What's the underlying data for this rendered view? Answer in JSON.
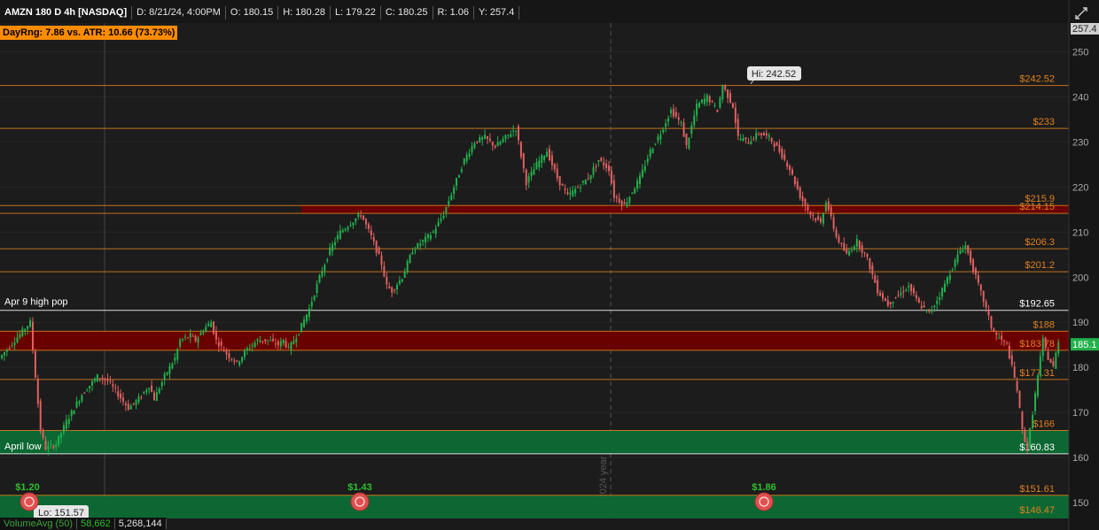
{
  "header": {
    "symbol": "AMZN 180 D 4h [NASDAQ]",
    "date": "D: 8/21/24, 4:00PM",
    "open": "O: 180.15",
    "high": "H: 180.28",
    "low": "L: 179.22",
    "close": "C: 180.25",
    "range": "R: 1.06",
    "y": "Y: 257.4"
  },
  "day_range_badge": "DayRng: 7.86 vs. ATR: 10.66 (73.73%)",
  "year_separator_label": "2024 year",
  "labels": {
    "apr9": "Apr 9 high pop",
    "april_low": "April low",
    "hi": "Hi: 242.52",
    "lo": "Lo: 151.57"
  },
  "dividends": [
    "$1.20",
    "$1.43",
    "$1.86"
  ],
  "price_axis": {
    "ticks": [
      "250",
      "240",
      "230",
      "220",
      "210",
      "200",
      "190",
      "180",
      "170",
      "160",
      "150"
    ],
    "top_value": "257.4",
    "current_price": "185.1"
  },
  "levels": [
    {
      "label": "$242.52",
      "color": "#e08020"
    },
    {
      "label": "$233",
      "color": "#e08020"
    },
    {
      "label": "$215.9",
      "color": "#e08020"
    },
    {
      "label": "$214.15",
      "color": "#e08020"
    },
    {
      "label": "$206.3",
      "color": "#e08020"
    },
    {
      "label": "$201.2",
      "color": "#e08020"
    },
    {
      "label": "$192.65",
      "color": "#ffffff"
    },
    {
      "label": "$188",
      "color": "#e08020"
    },
    {
      "label": "$183.78",
      "color": "#e08020"
    },
    {
      "label": "$177.31",
      "color": "#e08020"
    },
    {
      "label": "$166",
      "color": "#e08020"
    },
    {
      "label": "$160.83",
      "color": "#ffffff"
    },
    {
      "label": "$151.61",
      "color": "#e08020"
    },
    {
      "label": "$146.47",
      "color": "#e08020"
    }
  ],
  "volume": {
    "name": "VolumeAvg (50)",
    "avg": "58,662",
    "value": "5,268,144"
  },
  "colors": {
    "up": "#22b14c",
    "down": "#e06060",
    "red_zone": "#6e0000",
    "green_zone": "#0c6b34",
    "level_line": "#e08020"
  },
  "chart_data": {
    "type": "candlestick",
    "ylim": [
      145,
      257.4
    ],
    "price_path": [
      [
        0,
        182
      ],
      [
        3,
        186
      ],
      [
        6,
        190
      ],
      [
        7,
        178
      ],
      [
        8,
        166
      ],
      [
        9,
        162
      ],
      [
        11,
        163
      ],
      [
        13,
        168
      ],
      [
        16,
        174
      ],
      [
        19,
        178
      ],
      [
        21,
        177
      ],
      [
        23,
        174
      ],
      [
        25,
        171
      ],
      [
        27,
        173
      ],
      [
        29,
        176
      ],
      [
        30,
        173
      ],
      [
        32,
        178
      ],
      [
        34,
        182
      ],
      [
        35,
        186
      ],
      [
        37,
        187
      ],
      [
        38,
        186
      ],
      [
        40,
        189
      ],
      [
        41,
        190
      ],
      [
        42,
        186
      ],
      [
        44,
        183
      ],
      [
        46,
        181
      ],
      [
        48,
        184
      ],
      [
        50,
        186
      ],
      [
        52,
        186
      ],
      [
        54,
        185
      ],
      [
        55,
        186
      ],
      [
        56,
        184
      ],
      [
        58,
        188
      ],
      [
        60,
        193
      ],
      [
        62,
        200
      ],
      [
        64,
        206
      ],
      [
        66,
        210
      ],
      [
        68,
        212
      ],
      [
        70,
        214
      ],
      [
        72,
        209
      ],
      [
        74,
        203
      ],
      [
        75,
        198
      ],
      [
        76,
        197
      ],
      [
        78,
        200
      ],
      [
        80,
        206
      ],
      [
        82,
        208
      ],
      [
        84,
        210
      ],
      [
        86,
        214
      ],
      [
        88,
        220
      ],
      [
        90,
        226
      ],
      [
        92,
        230
      ],
      [
        94,
        231
      ],
      [
        96,
        229
      ],
      [
        98,
        231
      ],
      [
        100,
        233
      ],
      [
        101,
        227
      ],
      [
        102,
        221
      ],
      [
        104,
        225
      ],
      [
        106,
        228
      ],
      [
        108,
        222
      ],
      [
        110,
        218
      ],
      [
        112,
        220
      ],
      [
        114,
        222
      ],
      [
        116,
        226
      ],
      [
        118,
        224
      ],
      [
        119,
        218
      ],
      [
        121,
        216
      ],
      [
        122,
        218
      ],
      [
        124,
        222
      ],
      [
        126,
        228
      ],
      [
        128,
        232
      ],
      [
        130,
        237
      ],
      [
        132,
        234
      ],
      [
        133,
        229
      ],
      [
        135,
        238
      ],
      [
        137,
        240
      ],
      [
        139,
        237
      ],
      [
        140,
        242.5
      ],
      [
        142,
        238
      ],
      [
        143,
        231
      ],
      [
        145,
        230
      ],
      [
        147,
        232
      ],
      [
        149,
        231
      ],
      [
        151,
        228
      ],
      [
        153,
        224
      ],
      [
        155,
        218
      ],
      [
        157,
        214
      ],
      [
        159,
        212
      ],
      [
        160,
        217
      ],
      [
        162,
        209
      ],
      [
        164,
        205
      ],
      [
        166,
        208
      ],
      [
        168,
        204
      ],
      [
        170,
        197
      ],
      [
        172,
        194
      ],
      [
        174,
        196
      ],
      [
        176,
        198
      ],
      [
        178,
        194
      ],
      [
        180,
        192
      ],
      [
        182,
        196
      ],
      [
        184,
        201
      ],
      [
        186,
        206
      ],
      [
        187,
        207
      ],
      [
        189,
        200
      ],
      [
        191,
        193
      ],
      [
        192,
        189
      ],
      [
        193,
        187
      ],
      [
        195,
        185
      ],
      [
        197,
        175
      ],
      [
        198,
        166
      ],
      [
        199,
        162
      ],
      [
        200,
        170
      ],
      [
        201,
        178
      ],
      [
        202,
        186
      ],
      [
        203,
        182
      ],
      [
        204,
        180
      ],
      [
        205,
        186
      ]
    ],
    "notes": "x values are bar index (0-205) over the 180-day 4h window; y values are prices in USD"
  }
}
